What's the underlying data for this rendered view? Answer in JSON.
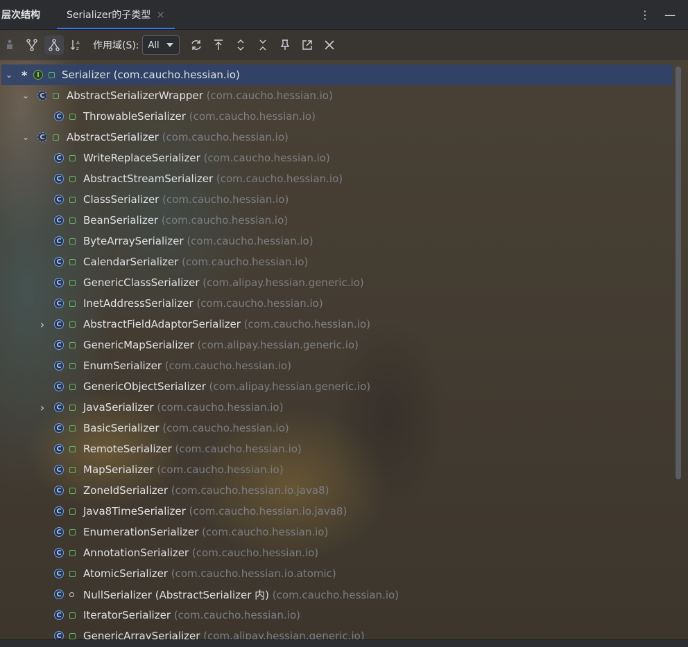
{
  "window": {
    "tool_title": "层次结构",
    "tab_label": "Serializer的子类型",
    "tab_close": "×",
    "more_icon": "more-vertical-icon",
    "minimize_icon": "minimize-icon"
  },
  "toolbar": {
    "scope_label": "作用域(S):",
    "scope_value": "All"
  },
  "tree": {
    "root": {
      "name": "Serializer (com.caucho.hessian.io)",
      "star": "*"
    },
    "rows": [
      {
        "name": "AbstractSerializerWrapper",
        "pkg": " (com.caucho.hessian.io)"
      },
      {
        "name": "ThrowableSerializer",
        "pkg": " (com.caucho.hessian.io)"
      },
      {
        "name": "AbstractSerializer",
        "pkg": " (com.caucho.hessian.io)"
      },
      {
        "name": "WriteReplaceSerializer",
        "pkg": " (com.caucho.hessian.io)"
      },
      {
        "name": "AbstractStreamSerializer",
        "pkg": " (com.caucho.hessian.io)"
      },
      {
        "name": "ClassSerializer",
        "pkg": " (com.caucho.hessian.io)"
      },
      {
        "name": "BeanSerializer",
        "pkg": " (com.caucho.hessian.io)"
      },
      {
        "name": "ByteArraySerializer",
        "pkg": " (com.caucho.hessian.io)"
      },
      {
        "name": "CalendarSerializer",
        "pkg": " (com.caucho.hessian.io)"
      },
      {
        "name": "GenericClassSerializer",
        "pkg": " (com.alipay.hessian.generic.io)"
      },
      {
        "name": "InetAddressSerializer",
        "pkg": " (com.caucho.hessian.io)"
      },
      {
        "name": "AbstractFieldAdaptorSerializer",
        "pkg": " (com.caucho.hessian.io)"
      },
      {
        "name": "GenericMapSerializer",
        "pkg": " (com.alipay.hessian.generic.io)"
      },
      {
        "name": "EnumSerializer",
        "pkg": " (com.caucho.hessian.io)"
      },
      {
        "name": "GenericObjectSerializer",
        "pkg": " (com.alipay.hessian.generic.io)"
      },
      {
        "name": "JavaSerializer",
        "pkg": " (com.caucho.hessian.io)"
      },
      {
        "name": "BasicSerializer",
        "pkg": " (com.caucho.hessian.io)"
      },
      {
        "name": "RemoteSerializer",
        "pkg": " (com.caucho.hessian.io)"
      },
      {
        "name": "MapSerializer",
        "pkg": " (com.caucho.hessian.io)"
      },
      {
        "name": "ZoneIdSerializer",
        "pkg": " (com.caucho.hessian.io.java8)"
      },
      {
        "name": "Java8TimeSerializer",
        "pkg": " (com.caucho.hessian.io.java8)"
      },
      {
        "name": "EnumerationSerializer",
        "pkg": " (com.caucho.hessian.io)"
      },
      {
        "name": "AnnotationSerializer",
        "pkg": " (com.caucho.hessian.io)"
      },
      {
        "name": "AtomicSerializer",
        "pkg": " (com.caucho.hessian.io.atomic)"
      },
      {
        "name": "NullSerializer (AbstractSerializer 内)",
        "pkg": " (com.caucho.hessian.io)"
      },
      {
        "name": "IteratorSerializer",
        "pkg": " (com.caucho.hessian.io)"
      },
      {
        "name": "GenericArraySerializer",
        "pkg": " (com.alipay.hessian.generic.io)"
      }
    ]
  }
}
